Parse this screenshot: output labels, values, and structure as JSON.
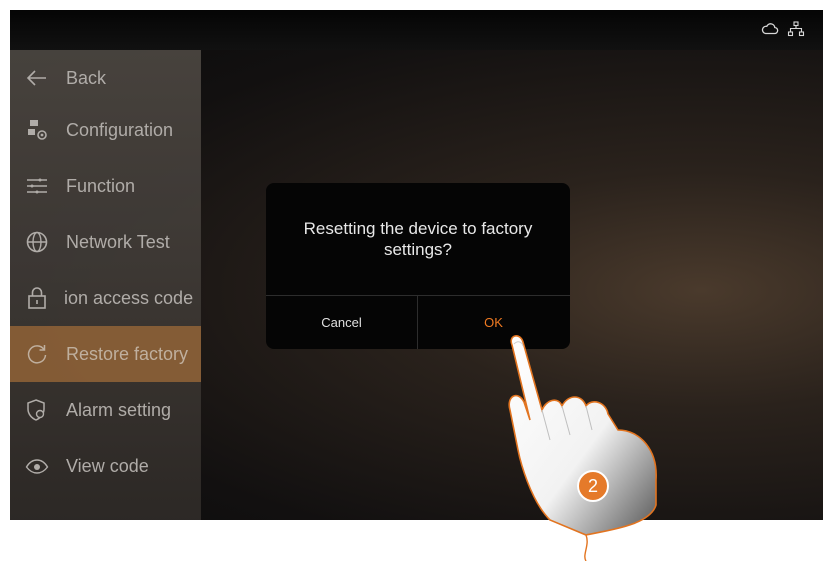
{
  "status_bar": {
    "icons": [
      "cloud-icon",
      "network-icon"
    ]
  },
  "sidebar": {
    "items": [
      {
        "label": "Back",
        "icon": "arrow-left-icon"
      },
      {
        "label": "Configuration",
        "icon": "configuration-icon"
      },
      {
        "label": "Function",
        "icon": "sliders-icon"
      },
      {
        "label": "Network Test",
        "icon": "globe-icon"
      },
      {
        "label": "ion access code",
        "icon": "lock-icon"
      },
      {
        "label": "Restore factory",
        "icon": "restore-icon",
        "active": true
      },
      {
        "label": "Alarm setting",
        "icon": "alarm-shield-icon"
      },
      {
        "label": "View code",
        "icon": "eye-icon"
      }
    ]
  },
  "dialog": {
    "message": "Resetting the device to factory settings?",
    "cancel_label": "Cancel",
    "ok_label": "OK"
  },
  "annotation": {
    "step_number": "2"
  },
  "colors": {
    "accent": "#f07a22",
    "active_item_bg": "#8a6038",
    "badge": "#e57a2a"
  }
}
